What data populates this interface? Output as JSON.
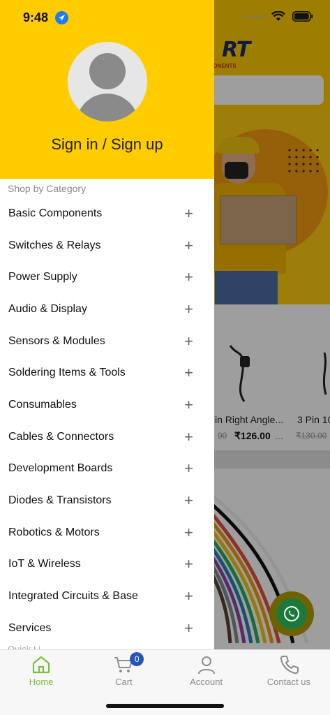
{
  "status_bar": {
    "time": "9:48"
  },
  "background": {
    "logo_text": "RT",
    "logo_sub": "PONENTS",
    "products": [
      {
        "name": "in Right Angle...",
        "old_price": "90",
        "price": "₹126.00",
        "more": "..."
      },
      {
        "name": "3 Pin 10",
        "old_price": "₹130.00"
      }
    ]
  },
  "drawer": {
    "sign_in": "Sign in / Sign up",
    "section_title": "Shop by Category",
    "categories": [
      {
        "label": "Basic Components"
      },
      {
        "label": "Switches & Relays"
      },
      {
        "label": "Power Supply"
      },
      {
        "label": "Audio & Display"
      },
      {
        "label": "Sensors & Modules"
      },
      {
        "label": "Soldering Items & Tools"
      },
      {
        "label": "Consumables"
      },
      {
        "label": "Cables & Connectors"
      },
      {
        "label": "Development Boards"
      },
      {
        "label": "Diodes & Transistors"
      },
      {
        "label": "Robotics & Motors"
      },
      {
        "label": "IoT & Wireless"
      },
      {
        "label": "Integrated Circuits & Base"
      },
      {
        "label": "Services"
      }
    ],
    "expand_symbol": "+",
    "next_section_cut": "Quick Li..."
  },
  "bottom_nav": {
    "items": [
      {
        "label": "Home",
        "icon": "home-icon",
        "active": true
      },
      {
        "label": "Cart",
        "icon": "cart-icon",
        "badge": "0"
      },
      {
        "label": "Account",
        "icon": "account-icon"
      },
      {
        "label": "Contact us",
        "icon": "phone-icon"
      }
    ]
  },
  "colors": {
    "brand_yellow": "#ffcc00",
    "active_green": "#7ac142",
    "badge_blue": "#2456b8"
  }
}
